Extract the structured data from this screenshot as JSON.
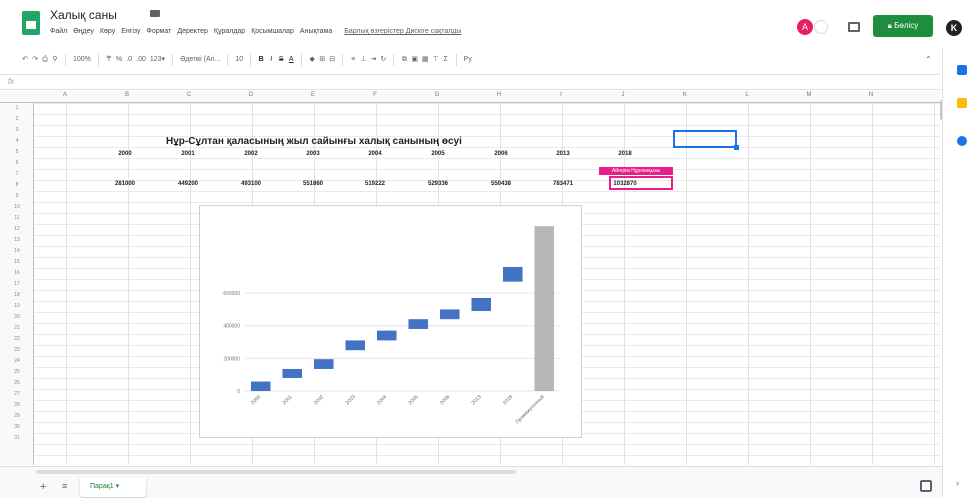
{
  "header": {
    "doc_title": "Халық саны",
    "menu": [
      "Файл",
      "Өңдеу",
      "Көру",
      "Енгізу",
      "Формат",
      "Деректер",
      "Құралдар",
      "Қосымшалар",
      "Анықтама"
    ],
    "last_edit": "Барлық өзгерістер Дискіге сақталды",
    "avatar_a": "A",
    "avatar_k": "K",
    "share_label": "Бөлісу"
  },
  "toolbar": {
    "undo": "↶",
    "redo": "↷",
    "print": "⎙",
    "paint": "⚲",
    "zoom": "100%",
    "currency": "₸",
    "percent": "%",
    "dec_less": ".0",
    "dec_more": ".00",
    "format_more": "123▾",
    "font": "Әдепкі (Ari...",
    "font_size": "10",
    "bold": "B",
    "italic": "I",
    "strike": "S",
    "text_color": "A",
    "fill": "◆",
    "borders": "⊞",
    "merge": "⊟",
    "halign": "≡",
    "valign": "⊥",
    "wrap": "⇥",
    "rotate": "↻",
    "link": "⧉",
    "comment": "▣",
    "chart": "▦",
    "filter": "⊤",
    "functions": "Σ",
    "input_tools": "Ру"
  },
  "formula_bar": {
    "fx": "fx"
  },
  "columns": [
    "A",
    "B",
    "C",
    "D",
    "E",
    "F",
    "G",
    "H",
    "I",
    "J",
    "K",
    "L",
    "M",
    "N"
  ],
  "rows": [
    "1",
    "2",
    "3",
    "4",
    "5",
    "6",
    "7",
    "8",
    "9",
    "10",
    "11",
    "12",
    "13",
    "14",
    "15",
    "16",
    "17",
    "18",
    "19",
    "20",
    "21",
    "22",
    "23",
    "24",
    "25",
    "26",
    "27",
    "28",
    "29",
    "30",
    "31"
  ],
  "sheet": {
    "title": "Нұр-Сұлтан қаласының жыл сайынғы халық санының өсуі",
    "years": [
      "2000",
      "2001",
      "2002",
      "2003",
      "2004",
      "2005",
      "2006",
      "2013",
      "2018"
    ],
    "values": [
      "281000",
      "449200",
      "493100",
      "551860",
      "519222",
      "529336",
      "550438",
      "783471",
      "1032870"
    ],
    "collaborator_label": "Айгерім Нұрланқызы"
  },
  "chart_data": {
    "type": "bar",
    "subtype": "waterfall",
    "categories": [
      "2000",
      "2001",
      "2002",
      "2003",
      "2004",
      "2005",
      "2006",
      "2013",
      "2018",
      "Промежуточный"
    ],
    "series": [
      {
        "values": [
          [
            0,
            58000
          ],
          [
            80000,
            135000
          ],
          [
            135000,
            195000
          ],
          [
            250000,
            310000
          ],
          [
            310000,
            370000
          ],
          [
            380000,
            440000
          ],
          [
            440000,
            500000
          ],
          [
            490000,
            570000
          ],
          [
            670000,
            760000
          ],
          [
            0,
            1010000
          ]
        ]
      }
    ],
    "y_ticks": [
      "0",
      "200000",
      "400000",
      "600000"
    ],
    "ylim": [
      0,
      1060000
    ],
    "colors": {
      "increase": "#4472c4",
      "total": "#b7b7b7"
    },
    "grid": true
  },
  "bottom": {
    "add_sheet": "+",
    "all_sheets": "≡",
    "sheet_tab": "Парақ1 ▾"
  },
  "colors": {
    "accent": "#1e8e3e",
    "selection": "#1a73e8",
    "collaborator": "#e91e8c"
  }
}
